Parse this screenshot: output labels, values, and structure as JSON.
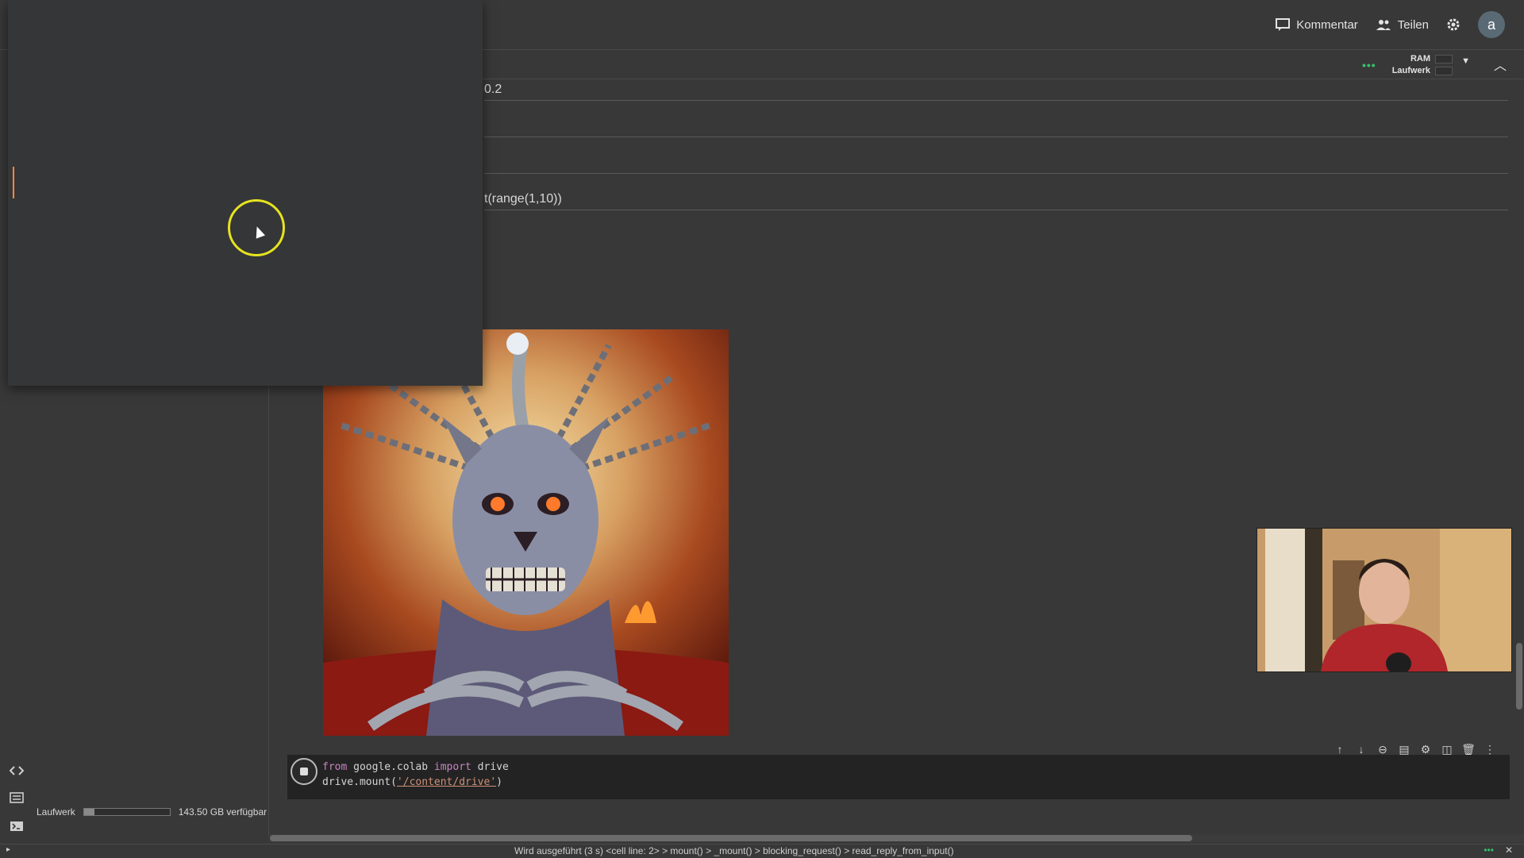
{
  "header": {
    "comment_label": "Kommentar",
    "share_label": "Teilen",
    "avatar_initial": "a"
  },
  "resources": {
    "ram_label": "RAM",
    "disk_label": "Laufwerk"
  },
  "code_fragments": {
    "line1": "0.2",
    "line2": "t(range(1,10))"
  },
  "sidebar": {
    "disk_label": "Laufwerk",
    "disk_available": "143.50 GB verfügbar",
    "disk_usage_fraction": 0.12
  },
  "code_cell": {
    "line1_kw_from": "from",
    "line1_module": " google.colab ",
    "line1_kw_import": "import",
    "line1_name": " drive",
    "line2_prefix": "drive.mount(",
    "line2_string": "'/content/drive'",
    "line2_suffix": ")"
  },
  "status": {
    "text": "Wird ausgeführt (3 s) <cell line: 2> > mount() > _mount() > blocking_request() > read_reply_from_input()"
  },
  "icons": {
    "comment": "comment-icon",
    "share": "people-icon",
    "settings": "gear-icon",
    "code": "code-icon",
    "snippets": "list-icon",
    "terminal": "terminal-icon"
  },
  "colors": {
    "background": "#383838",
    "accent_cursor": "#e6e320",
    "status_green": "#35c26b"
  }
}
